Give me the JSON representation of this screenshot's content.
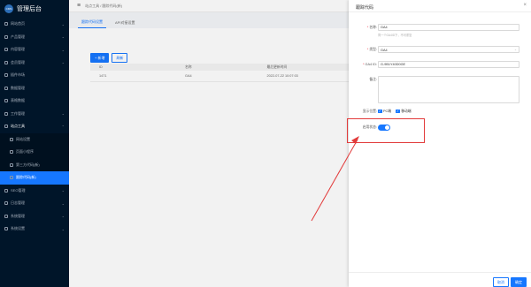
{
  "brand": {
    "logo_text": "CMS",
    "title": "管理后台"
  },
  "sidebar": {
    "items": [
      {
        "label": "网站首页"
      },
      {
        "label": "产品管理"
      },
      {
        "label": "内容管理"
      },
      {
        "label": "会员管理"
      },
      {
        "label": "插件市场"
      },
      {
        "label": "数据管理"
      },
      {
        "label": "表格数据"
      },
      {
        "label": "工作管理"
      },
      {
        "label": "站点工具"
      }
    ],
    "submenu": [
      {
        "label": "网站设置"
      },
      {
        "label": "页面小程序"
      },
      {
        "label": "第三方代码(新)"
      },
      {
        "label": "跟踪代码(新)"
      }
    ],
    "items_after": [
      {
        "label": "SEO管理"
      },
      {
        "label": "日志管理"
      },
      {
        "label": "系统管理"
      },
      {
        "label": "系统设置"
      }
    ]
  },
  "topbar": {
    "breadcrumb": "站点工具 / 跟踪代码(新)"
  },
  "tabs": [
    {
      "label": "跟踪代码设置"
    },
    {
      "label": "API对接设置"
    }
  ],
  "toolbar": {
    "add_label": "+ 新增",
    "refresh_label": "刷新"
  },
  "table": {
    "headers": [
      "ID",
      "名称",
      "最后更新时间",
      ""
    ],
    "rows": [
      [
        "1471",
        "GA4",
        "2022-07-22 10:07:03",
        ""
      ]
    ]
  },
  "drawer": {
    "title": "跟踪代码",
    "close": "×",
    "fields": {
      "name_label": "名称:",
      "name_value": "GA4",
      "name_hint": "同一个GA4ID下，不可重复",
      "type_label": "类型:",
      "type_value": "GA4",
      "ga4id_label": "GA4 ID:",
      "ga4id_value": "G-9B1Y40D0GE",
      "remark_label": "备注:",
      "remark_value": "",
      "placement_label": "显示位置:",
      "placement_options": [
        "PC端",
        "移动端"
      ],
      "enable_label": "启用状态:",
      "enable_on": true
    },
    "cancel_label": "取消",
    "confirm_label": "确定"
  },
  "colors": {
    "sidebar_bg": "#001529",
    "accent": "#1677ff",
    "annotation_red": "#e23b3b"
  }
}
